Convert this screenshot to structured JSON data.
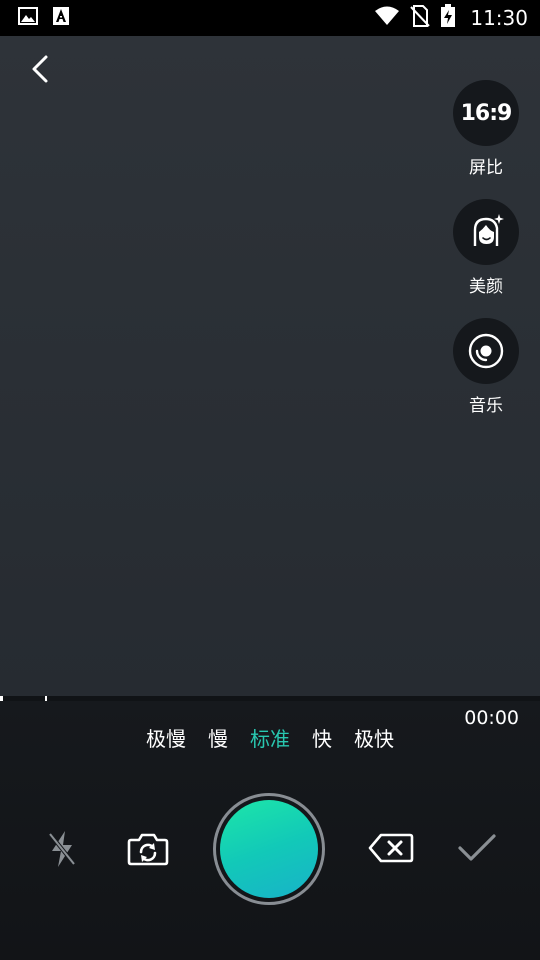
{
  "status_bar": {
    "time": "11:30",
    "icons": [
      "image-icon",
      "text-a-icon",
      "wifi-icon",
      "no-sim-icon",
      "battery-charging-icon"
    ]
  },
  "top": {
    "back_icon": "chevron-left-icon"
  },
  "side_tools": [
    {
      "id": "ratio",
      "badge": "16:9",
      "label": "屏比",
      "icon": "ratio-badge"
    },
    {
      "id": "beauty",
      "label": "美颜",
      "icon": "face-sparkle-icon"
    },
    {
      "id": "music",
      "label": "音乐",
      "icon": "disc-icon"
    }
  ],
  "timer": "00:00",
  "speeds": [
    "极慢",
    "慢",
    "标准",
    "快",
    "极快"
  ],
  "active_speed": "标准",
  "colors": {
    "accent": "#29c7b0",
    "record_gradient_start": "#1de6a8",
    "record_gradient_end": "#18b2c9",
    "preview_bg": "#2b3036"
  },
  "bottom_icons": {
    "flash": "flash-off-icon",
    "switch_camera": "camera-switch-icon",
    "delete": "backspace-icon",
    "confirm": "checkmark-icon"
  }
}
